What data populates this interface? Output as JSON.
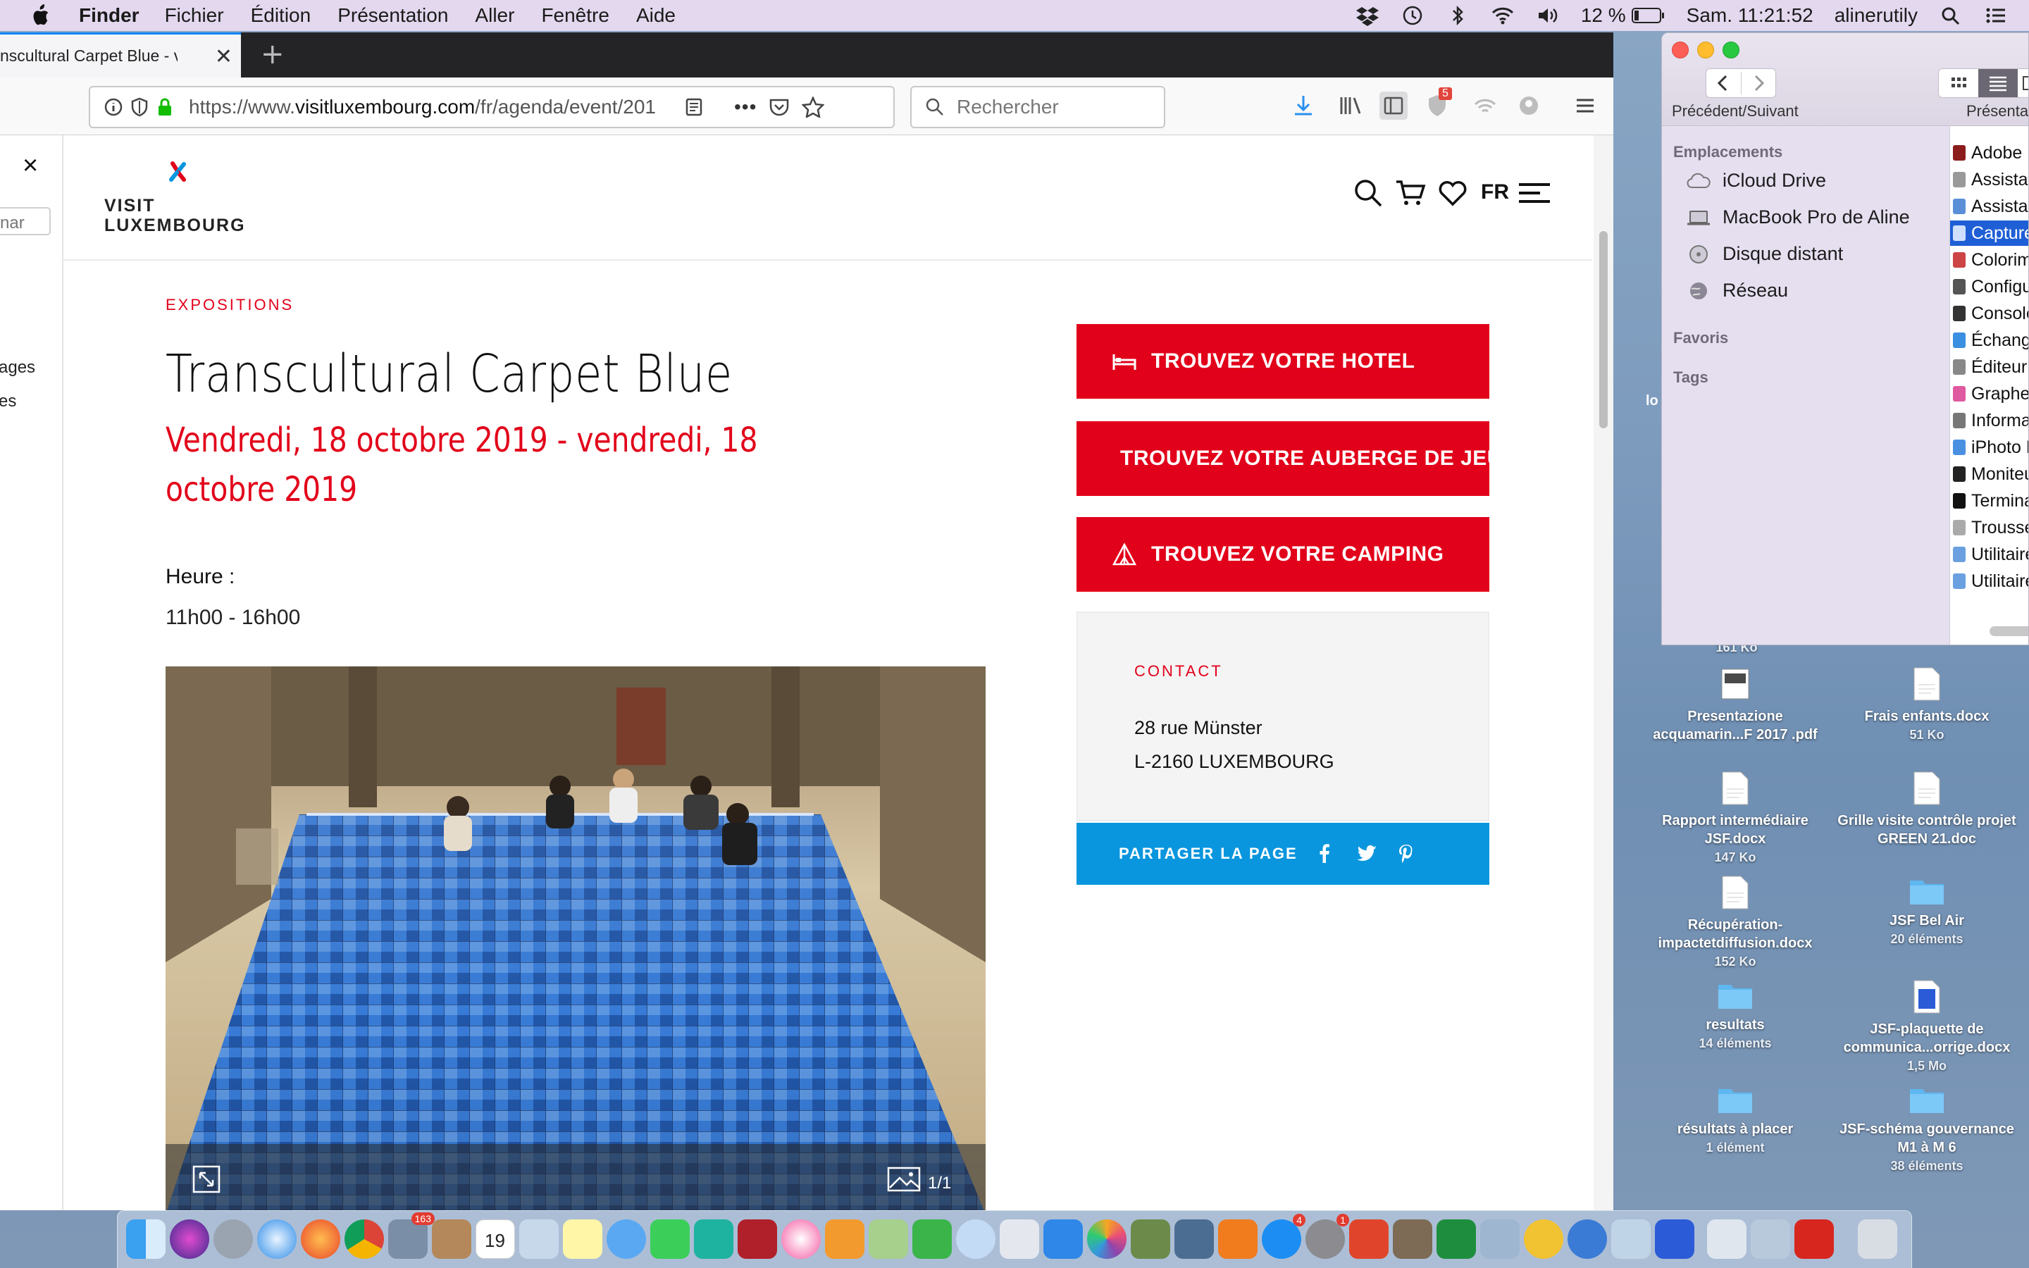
{
  "menubar": {
    "items": [
      "Finder",
      "Fichier",
      "Édition",
      "Présentation",
      "Aller",
      "Fenêtre",
      "Aide"
    ],
    "battery": "12 %",
    "clock": "Sam. 11:21:52",
    "user": "alinerutily"
  },
  "browser": {
    "tab_title": "nscultural Carpet Blue - vendredi",
    "url_prefix": "https://www.",
    "url_domain": "visitluxembourg.com",
    "url_path": "/fr/agenda/event/201",
    "search_placeholder": "Rechercher",
    "badge_count": "5",
    "sidebar_close": "×",
    "sidebar_texts": [
      "nar",
      "ages",
      "es"
    ]
  },
  "site": {
    "logo_line1": "VISIT",
    "logo_line2": "LUXEMBOURG",
    "lang": "FR",
    "category": "EXPOSITIONS",
    "title": "Transcultural Carpet Blue",
    "dates": "Vendredi, 18 octobre 2019  -  vendredi, 18 octobre 2019",
    "hour_label": "Heure :",
    "hour_value": "11h00 - 16h00",
    "photo_counter": "1/1",
    "buttons": {
      "hotel": "TROUVEZ VOTRE HOTEL",
      "auberge": "TROUVEZ VOTRE AUBERGE DE JEUNES",
      "camping": "TROUVEZ VOTRE CAMPING"
    },
    "contact": {
      "label": "CONTACT",
      "line1": "28 rue Münster",
      "line2": "L-2160 LUXEMBOURG"
    },
    "share_label": "PARTAGER LA PAGE"
  },
  "finder": {
    "nav_label": "Précédent/Suivant",
    "view_label": "Présenta",
    "section_places": "Emplacements",
    "places": [
      "iCloud Drive",
      "MacBook Pro de Aline",
      "Disque distant",
      "Réseau"
    ],
    "section_favorites": "Favoris",
    "section_tags": "Tags",
    "files": [
      "Adobe F",
      "Assistan",
      "Assistan",
      "Capture",
      "Colorim",
      "Configu",
      "Console",
      "Échange",
      "Éditeur",
      "Grapher",
      "Informat",
      "iPhoto L",
      "Moniteu",
      "Terminal",
      "Trousse",
      "Utilitaire",
      "Utilitaire"
    ],
    "selected_index": 3,
    "partial_label": "lo"
  },
  "desktop": {
    "partial_size": "161 Ko",
    "icons": [
      {
        "name": "Presentazione acquamarin...F 2017 .pdf",
        "sub": ""
      },
      {
        "name": "Frais enfants.docx",
        "sub": "51 Ko"
      },
      {
        "name": "Rapport intermédiaire JSF.docx",
        "sub": "147 Ko"
      },
      {
        "name": "Grille visite contrôle projet GREEN 21.doc",
        "sub": ""
      },
      {
        "name": "Récupération-impactetdiffusion.docx",
        "sub": "152 Ko"
      },
      {
        "name": "JSF Bel Air",
        "sub": "20 éléments"
      },
      {
        "name": "resultats",
        "sub": "14 éléments"
      },
      {
        "name": "JSF-plaquette de communica...orrige.docx",
        "sub": "1,5 Mo"
      },
      {
        "name": "résultats à placer",
        "sub": "1 élément"
      },
      {
        "name": "JSF-schéma gouvernance M1 à M 6",
        "sub": "38 éléments"
      }
    ]
  },
  "dock": {
    "calendar_day": "19",
    "mail_badge": "163",
    "appstore_badge": "4",
    "prefs_badge": "1"
  },
  "colors": {
    "brand_red": "#e2011a",
    "share_blue": "#0996de",
    "finder_selection": "#1f5fd6"
  }
}
